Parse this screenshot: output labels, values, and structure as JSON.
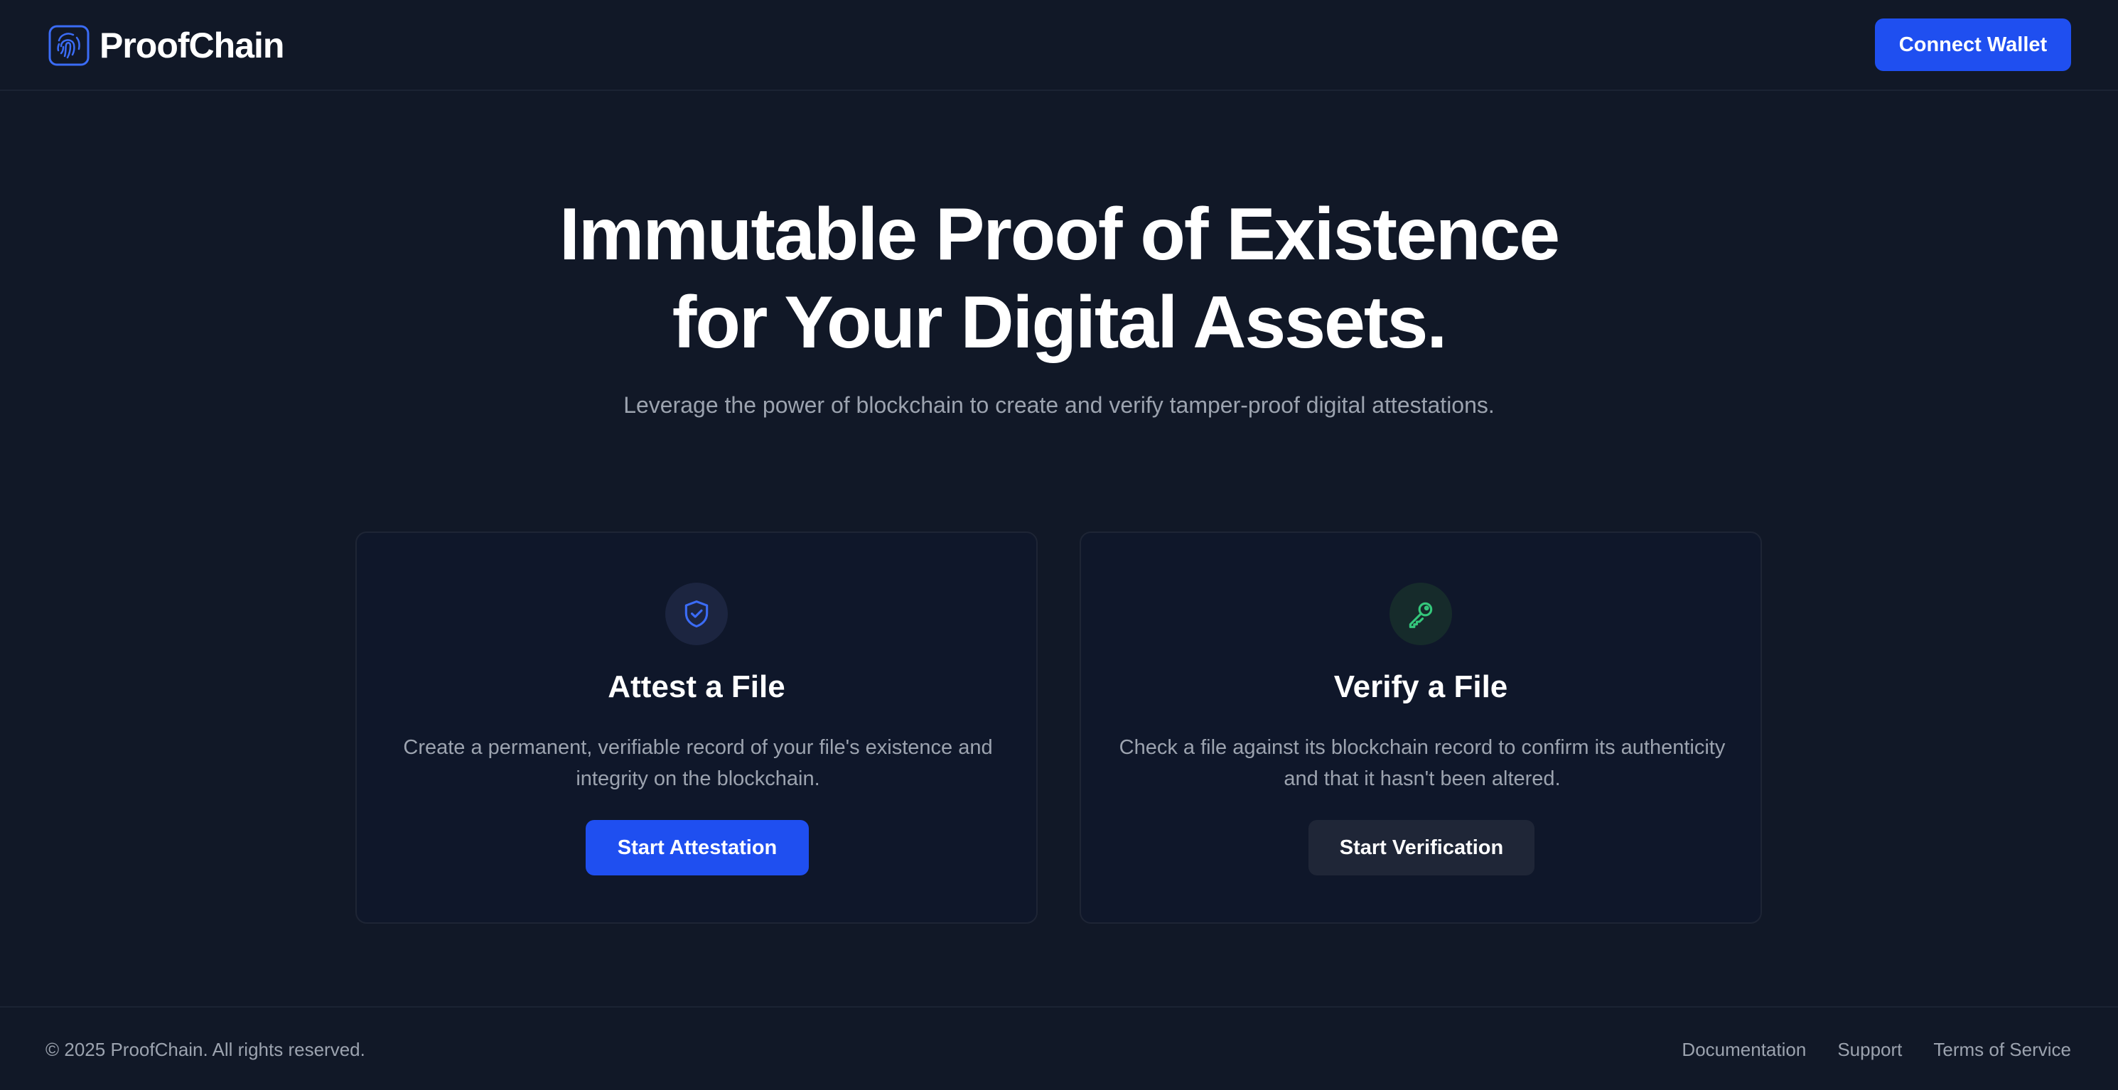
{
  "header": {
    "brand_name": "ProofChain",
    "logo_icon": "fingerprint-icon",
    "connect_label": "Connect Wallet"
  },
  "hero": {
    "title_line1": "Immutable Proof of Existence",
    "title_line2": "for Your Digital Assets.",
    "subtitle": "Leverage the power of blockchain to create and verify tamper-proof digital attestations."
  },
  "cards": {
    "attest": {
      "icon": "shield-check-icon",
      "title": "Attest a File",
      "description": "Create a permanent, verifiable record of your file's existence and integrity on the blockchain.",
      "button_label": "Start Attestation"
    },
    "verify": {
      "icon": "key-icon",
      "title": "Verify a File",
      "description": "Check a file against its blockchain record to confirm its authenticity and that it hasn't been altered.",
      "button_label": "Start Verification"
    }
  },
  "footer": {
    "copyright": "© 2025 ProofChain. All rights reserved.",
    "links": [
      "Documentation",
      "Support",
      "Terms of Service"
    ]
  },
  "colors": {
    "background": "#111827",
    "card_background": "#0f172a",
    "primary": "#1f4ff0",
    "secondary_button": "#1f2637",
    "muted_text": "#9ca3af",
    "attest_icon": "#3b6cf6",
    "verify_icon": "#34c77b"
  }
}
